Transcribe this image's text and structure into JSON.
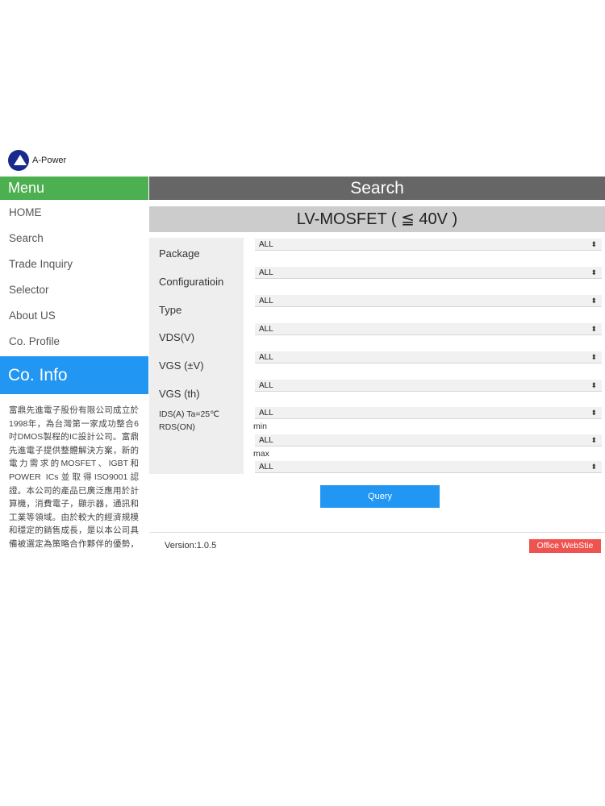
{
  "brand": {
    "name": "A-Power",
    "logo_icon": "a-power-logo-icon"
  },
  "sidebar": {
    "menu_title": "Menu",
    "items": [
      {
        "label": "HOME"
      },
      {
        "label": "Search"
      },
      {
        "label": "Trade Inquiry"
      },
      {
        "label": "Selector"
      },
      {
        "label": "About US"
      },
      {
        "label": "Co. Profile"
      }
    ],
    "coinfo_title": "Co. Info",
    "coinfo_text": "富鼎先進電子股份有限公司成立於1998年，為台灣第一家成功整合6吋DMOS製程的IC設計公司。富鼎先進電子提供整體解決方案，新的電力需求的MOSFET、IGBT和POWER ICs並取得ISO9001認證。本公司的產品已廣泛應用於計算機，消費電子，顯示器，通訊和工業等領域。由於較大的經濟規模和穩定的銷售成長，是以本公司具備被選定為策略合作夥伴的優勢，富"
  },
  "main": {
    "header": "Search",
    "category_title": "LV-MOSFET ( ≦ 40V )",
    "fields": [
      {
        "label": "Package",
        "value": "ALL"
      },
      {
        "label": "Configuratioin",
        "value": "ALL"
      },
      {
        "label": "Type",
        "value": "ALL"
      },
      {
        "label": "VDS(V)",
        "value": "ALL"
      },
      {
        "label": "VGS (±V)",
        "value": "ALL"
      },
      {
        "label": "VGS (th)",
        "value": "ALL"
      },
      {
        "label": "IDS(A) Ta=25℃",
        "value": "ALL"
      }
    ],
    "rds": {
      "label": "RDS(ON)",
      "min_label": "min",
      "min_value": "ALL",
      "max_label": "max",
      "max_value": "ALL"
    },
    "query_label": "Query",
    "version": "Version:1.0.5",
    "office_label": "Office WebStie"
  },
  "colors": {
    "menu_green": "#4caf50",
    "info_blue": "#2196f3",
    "header_gray": "#666666",
    "office_red": "#ef5350"
  }
}
